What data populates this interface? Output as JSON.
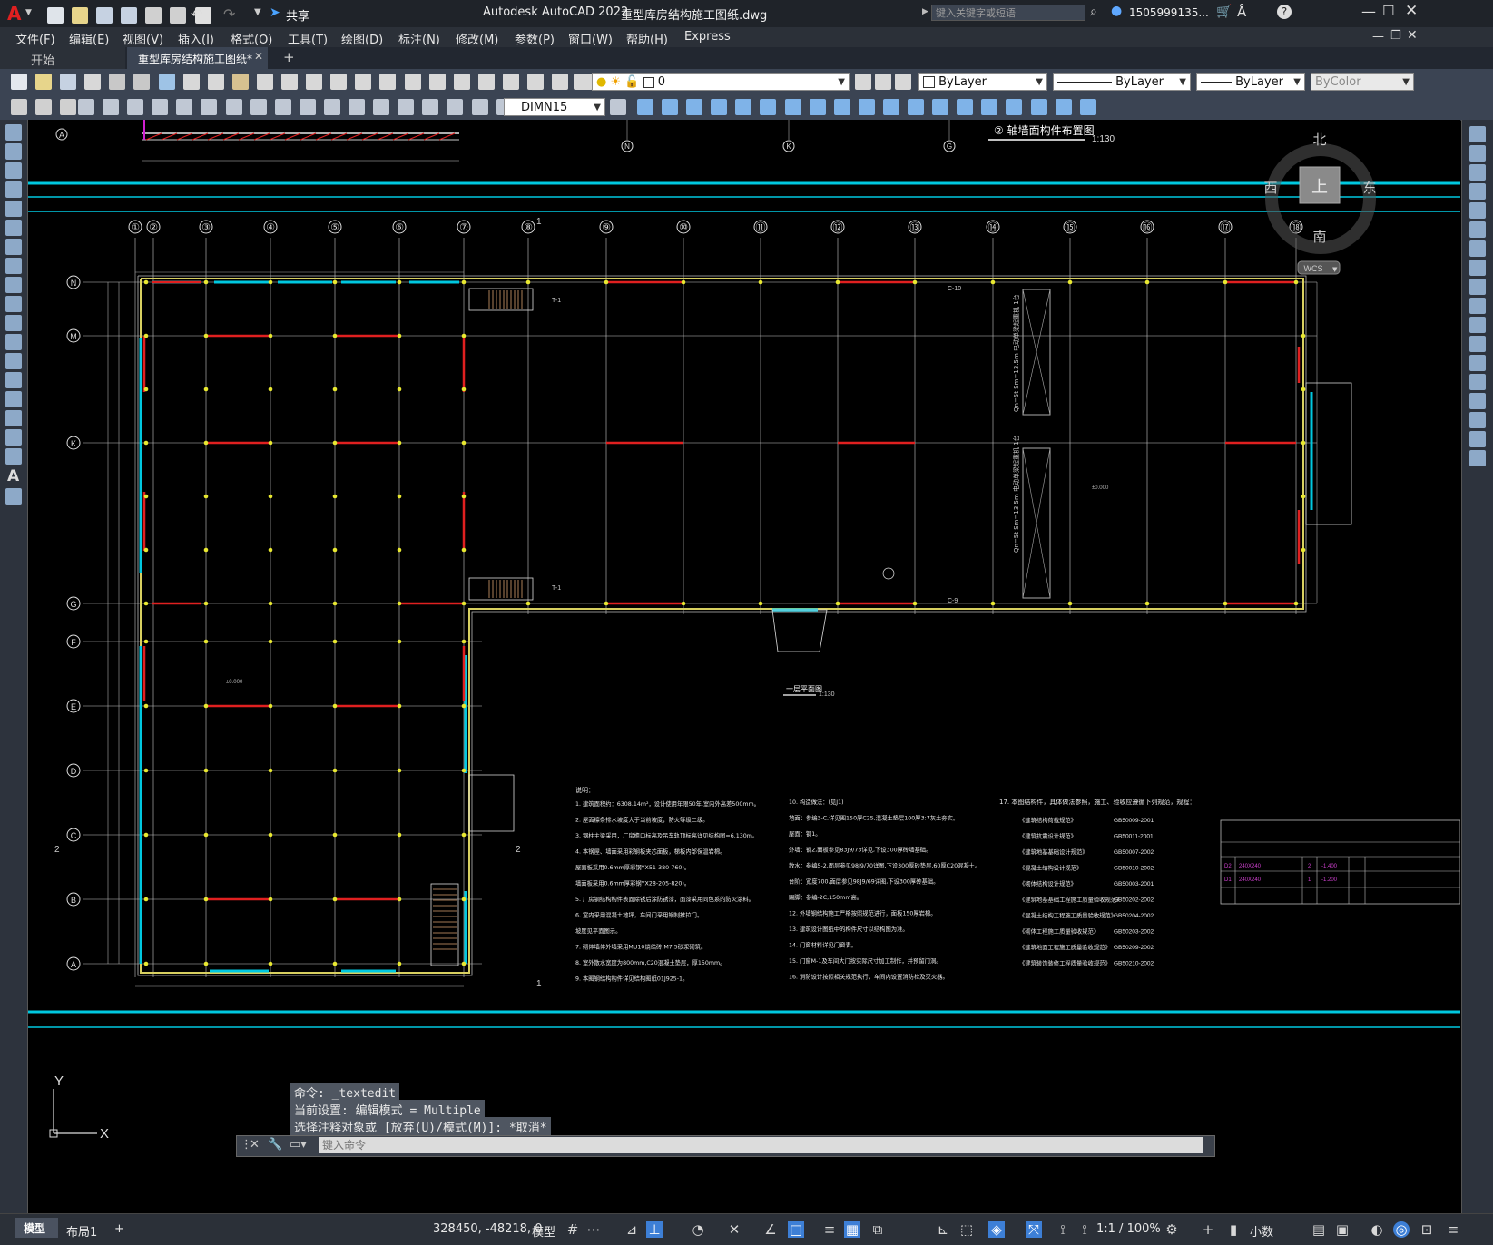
{
  "app": {
    "logo": "A",
    "title": "Autodesk AutoCAD 2022",
    "filename": "重型库房结构施工图纸.dwg",
    "search_placeholder": "键入关键字或短语",
    "user": "1505999135...",
    "share_label": "共享"
  },
  "menu": [
    "文件(F)",
    "编辑(E)",
    "视图(V)",
    "插入(I)",
    "格式(O)",
    "工具(T)",
    "绘图(D)",
    "标注(N)",
    "修改(M)",
    "参数(P)",
    "窗口(W)",
    "帮助(H)",
    "Express"
  ],
  "tabs": {
    "start": "开始",
    "active": "重型库房结构施工图纸*"
  },
  "toolbar": {
    "layer_value": "0",
    "color_value": "ByLayer",
    "linetype_value": "ByLayer",
    "lineweight_value": "ByLayer",
    "plotstyle_value": "ByColor",
    "dimstyle_value": "DIMN15"
  },
  "viewcube": {
    "north": "北",
    "south": "南",
    "east": "东",
    "west": "西",
    "top": "上",
    "wcs": "WCS"
  },
  "drawing": {
    "column_axes": [
      "①",
      "②",
      "③",
      "④",
      "⑤",
      "⑥",
      "⑦",
      "⑧",
      "⑨",
      "⑩",
      "⑪",
      "⑫",
      "⑬",
      "⑭",
      "⑮",
      "⑯",
      "⑰",
      "⑱"
    ],
    "row_axes": [
      "N",
      "M",
      "K",
      "G",
      "F",
      "E",
      "D",
      "C",
      "B",
      "A"
    ],
    "top_axes_left": [
      "A"
    ],
    "top_axes_mid": [
      "N",
      "K",
      "G"
    ],
    "title_elevation": "② 轴墙面构件布置图",
    "title_elevation_scale": "1:130",
    "title_plan": "一层平面图",
    "title_plan_scale": "1:130",
    "notes_heading": "说明：",
    "notes_col1": [
      "1. 建筑面积约：6308.14m²，设计使用年限50年,室内外高差500mm。",
      "2. 屋面檩条排水坡度大于当前坡度，防火等级二级。",
      "3. 钢柱主梁采用，厂房檐口标高及吊车轨顶标高详见结构图=6.130m。",
      "4. 本钢屋、墙面采用彩钢板夹芯面板，梯板内部保温岩棉。",
      "   屋面板采用0.6mm厚彩钢YX51-380-760)。",
      "   墙面板采用0.6mm厚彩钢YX28-205-820)。",
      "5. 厂房钢结构构件表面除锈后涂防锈漆，面漆采用同色系的防火涂料。",
      "6. 室内采用混凝土地坪，车间门采用钢制推拉门。",
      "   坡度见平面图示。",
      "7. 砌体墙体外墙采用MU10烧结砖,M7.5砂浆砌筑。",
      "8. 室外散水宽度为800mm,C20混凝土垫层，厚150mm。",
      "9. 本图钢结构构件详见结构图纸01J925-1。"
    ],
    "notes_col2": [
      "10. 构造做法：(见J1)",
      "地面：参编3-C,详见图150厚C25,混凝土垫层100厚3:7灰土夯实。",
      "屋面：钢1。",
      "外墙：钢2,面板参见83J9/73详见,下设300厚砖墙基础。",
      "散水：参编5-2,面层参见98J9/70详图,下设300厚砂垫层,60厚C20混凝土。",
      "台阶：宽度700,面层参见98J9/69详图,下设300厚砖基础。",
      "踢脚：参编-2C,150mm高。",
      "12. 外墙钢结构施工严格按照规范进行，面板150厚岩棉。",
      "13. 建筑设计图纸中的构件尺寸以结构图为准。",
      "14. 门窗材料详见门窗表。",
      "15. 门窗M-1及车间大门按实际尺寸加工制作，并预留门洞。",
      "16. 消防设计按照相关规范执行，车间内设置消防栓及灭火器。"
    ],
    "notes_col3_heading": "17. 本图结构件，具体做法参照，施工、验收应遵循下列规范，规程：",
    "standards": [
      {
        "name": "《建筑结构荷载规范》",
        "code": "GB50009-2001"
      },
      {
        "name": "《建筑抗震设计规范》",
        "code": "GB50011-2001"
      },
      {
        "name": "《建筑地基基础设计规范》",
        "code": "GB50007-2002"
      },
      {
        "name": "《混凝土结构设计规范》",
        "code": "GB50010-2002"
      },
      {
        "name": "《砌体结构设计规范》",
        "code": "GB50003-2001"
      },
      {
        "name": "《建筑地基基础工程施工质量验收规范》",
        "code": "GB50202-2002"
      },
      {
        "name": "《混凝土结构工程施工质量验收规范》",
        "code": "GB50204-2002"
      },
      {
        "name": "《砌体工程施工质量验收规范》",
        "code": "GB50203-2002"
      },
      {
        "name": "《建筑地面工程施工质量验收规范》",
        "code": "GB50209-2002"
      },
      {
        "name": "《建筑装饰装修工程质量验收规范》",
        "code": "GB50210-2002"
      }
    ],
    "window_table": [
      {
        "id": "D2",
        "size": "240X240",
        "count": "2",
        "elev": "-1.400"
      },
      {
        "id": "D1",
        "size": "240X240",
        "count": "1",
        "elev": "-1.200"
      }
    ],
    "elevation_mark": "±0.000",
    "room_text_1": "Qn=5t Sm=13.5m 电动单梁起重机 1台",
    "room_text_2": "Qn=5t Sm=13.5m 电动单梁起重机 1台",
    "stair_label": "T-1",
    "door_label_1": "C-10",
    "door_label_2": "C-9",
    "section_mark_1": "1",
    "section_mark_2": "2"
  },
  "command": {
    "line1": "命令: _textedit",
    "line2": "当前设置: 编辑模式 = Multiple",
    "line3": "选择注释对象或 [放弃(U)/模式(M)]: *取消*",
    "placeholder": "键入命令"
  },
  "status": {
    "model_tab": "模型",
    "layout_tab": "布局1",
    "coords": "328450, -48218, 0",
    "model_label": "模型",
    "scale": "1:1 / 100%",
    "units": "小数"
  },
  "colors": {
    "cyan_rule": "#00c8e0",
    "beam_red": "#e02020",
    "column_yellow": "#e8e830",
    "grid_white": "#c8c8c8"
  }
}
